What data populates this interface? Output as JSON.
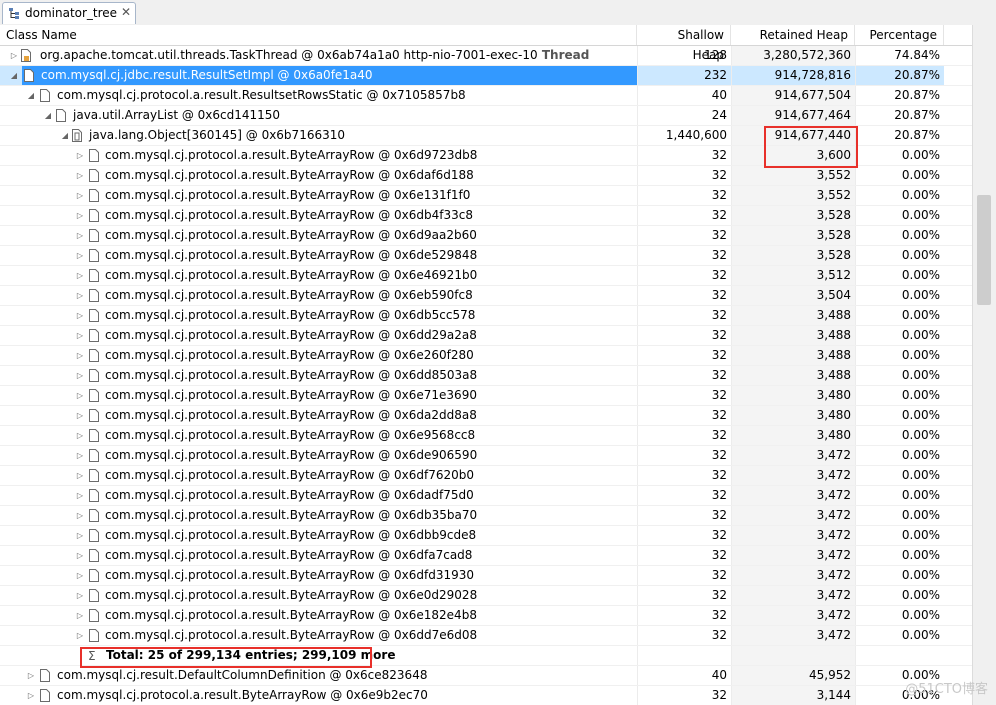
{
  "tab": {
    "label": "dominator_tree",
    "close": "✕"
  },
  "columns": {
    "class_name": "Class Name",
    "shallow_heap": "Shallow Heap",
    "retained_heap": "Retained Heap",
    "percentage": "Percentage"
  },
  "rows": [
    {
      "name": "org.apache.tomcat.util.threads.TaskThread @ 0x6ab74a1a0  http-nio-7001-exec-10",
      "suffix": "Thread",
      "shallow": "128",
      "retained": "3,280,572,360",
      "pct": "74.84%"
    },
    {
      "name": "com.mysql.cj.jdbc.result.ResultSetImpl @ 0x6a0fe1a40",
      "shallow": "232",
      "retained": "914,728,816",
      "pct": "20.87%"
    },
    {
      "name": "com.mysql.cj.protocol.a.result.ResultsetRowsStatic @ 0x7105857b8",
      "shallow": "40",
      "retained": "914,677,504",
      "pct": "20.87%"
    },
    {
      "name": "java.util.ArrayList @ 0x6cd141150",
      "shallow": "24",
      "retained": "914,677,464",
      "pct": "20.87%"
    },
    {
      "name": "java.lang.Object[360145] @ 0x6b7166310",
      "shallow": "1,440,600",
      "retained": "914,677,440",
      "pct": "20.87%"
    },
    {
      "name": "com.mysql.cj.protocol.a.result.ByteArrayRow @ 0x6d9723db8",
      "shallow": "32",
      "retained": "3,600",
      "pct": "0.00%"
    },
    {
      "name": "com.mysql.cj.protocol.a.result.ByteArrayRow @ 0x6daf6d188",
      "shallow": "32",
      "retained": "3,552",
      "pct": "0.00%"
    },
    {
      "name": "com.mysql.cj.protocol.a.result.ByteArrayRow @ 0x6e131f1f0",
      "shallow": "32",
      "retained": "3,552",
      "pct": "0.00%"
    },
    {
      "name": "com.mysql.cj.protocol.a.result.ByteArrayRow @ 0x6db4f33c8",
      "shallow": "32",
      "retained": "3,528",
      "pct": "0.00%"
    },
    {
      "name": "com.mysql.cj.protocol.a.result.ByteArrayRow @ 0x6d9aa2b60",
      "shallow": "32",
      "retained": "3,528",
      "pct": "0.00%"
    },
    {
      "name": "com.mysql.cj.protocol.a.result.ByteArrayRow @ 0x6de529848",
      "shallow": "32",
      "retained": "3,528",
      "pct": "0.00%"
    },
    {
      "name": "com.mysql.cj.protocol.a.result.ByteArrayRow @ 0x6e46921b0",
      "shallow": "32",
      "retained": "3,512",
      "pct": "0.00%"
    },
    {
      "name": "com.mysql.cj.protocol.a.result.ByteArrayRow @ 0x6eb590fc8",
      "shallow": "32",
      "retained": "3,504",
      "pct": "0.00%"
    },
    {
      "name": "com.mysql.cj.protocol.a.result.ByteArrayRow @ 0x6db5cc578",
      "shallow": "32",
      "retained": "3,488",
      "pct": "0.00%"
    },
    {
      "name": "com.mysql.cj.protocol.a.result.ByteArrayRow @ 0x6dd29a2a8",
      "shallow": "32",
      "retained": "3,488",
      "pct": "0.00%"
    },
    {
      "name": "com.mysql.cj.protocol.a.result.ByteArrayRow @ 0x6e260f280",
      "shallow": "32",
      "retained": "3,488",
      "pct": "0.00%"
    },
    {
      "name": "com.mysql.cj.protocol.a.result.ByteArrayRow @ 0x6dd8503a8",
      "shallow": "32",
      "retained": "3,488",
      "pct": "0.00%"
    },
    {
      "name": "com.mysql.cj.protocol.a.result.ByteArrayRow @ 0x6e71e3690",
      "shallow": "32",
      "retained": "3,480",
      "pct": "0.00%"
    },
    {
      "name": "com.mysql.cj.protocol.a.result.ByteArrayRow @ 0x6da2dd8a8",
      "shallow": "32",
      "retained": "3,480",
      "pct": "0.00%"
    },
    {
      "name": "com.mysql.cj.protocol.a.result.ByteArrayRow @ 0x6e9568cc8",
      "shallow": "32",
      "retained": "3,480",
      "pct": "0.00%"
    },
    {
      "name": "com.mysql.cj.protocol.a.result.ByteArrayRow @ 0x6de906590",
      "shallow": "32",
      "retained": "3,472",
      "pct": "0.00%"
    },
    {
      "name": "com.mysql.cj.protocol.a.result.ByteArrayRow @ 0x6df7620b0",
      "shallow": "32",
      "retained": "3,472",
      "pct": "0.00%"
    },
    {
      "name": "com.mysql.cj.protocol.a.result.ByteArrayRow @ 0x6dadf75d0",
      "shallow": "32",
      "retained": "3,472",
      "pct": "0.00%"
    },
    {
      "name": "com.mysql.cj.protocol.a.result.ByteArrayRow @ 0x6db35ba70",
      "shallow": "32",
      "retained": "3,472",
      "pct": "0.00%"
    },
    {
      "name": "com.mysql.cj.protocol.a.result.ByteArrayRow @ 0x6dbb9cde8",
      "shallow": "32",
      "retained": "3,472",
      "pct": "0.00%"
    },
    {
      "name": "com.mysql.cj.protocol.a.result.ByteArrayRow @ 0x6dfa7cad8",
      "shallow": "32",
      "retained": "3,472",
      "pct": "0.00%"
    },
    {
      "name": "com.mysql.cj.protocol.a.result.ByteArrayRow @ 0x6dfd31930",
      "shallow": "32",
      "retained": "3,472",
      "pct": "0.00%"
    },
    {
      "name": "com.mysql.cj.protocol.a.result.ByteArrayRow @ 0x6e0d29028",
      "shallow": "32",
      "retained": "3,472",
      "pct": "0.00%"
    },
    {
      "name": "com.mysql.cj.protocol.a.result.ByteArrayRow @ 0x6e182e4b8",
      "shallow": "32",
      "retained": "3,472",
      "pct": "0.00%"
    },
    {
      "name": "com.mysql.cj.protocol.a.result.ByteArrayRow @ 0x6dd7e6d08",
      "shallow": "32",
      "retained": "3,472",
      "pct": "0.00%"
    },
    {
      "name": "Total: 25 of 299,134 entries; 299,109 more",
      "shallow": "",
      "retained": "",
      "pct": ""
    },
    {
      "name": "com.mysql.cj.result.DefaultColumnDefinition @ 0x6ce823648",
      "shallow": "40",
      "retained": "45,952",
      "pct": "0.00%"
    },
    {
      "name": "com.mysql.cj.protocol.a.result.ByteArrayRow @ 0x6e9b2ec70",
      "shallow": "32",
      "retained": "3,144",
      "pct": "0.00%"
    }
  ],
  "watermark": "@51CTO博客",
  "colors": {
    "selection": "#3399ff",
    "highlight_box": "#e8302a"
  },
  "icons": {
    "tab": "dominator-tree-icon",
    "thread": "thread-icon",
    "object": "object-icon",
    "array": "array-icon",
    "total": "sum-icon"
  }
}
